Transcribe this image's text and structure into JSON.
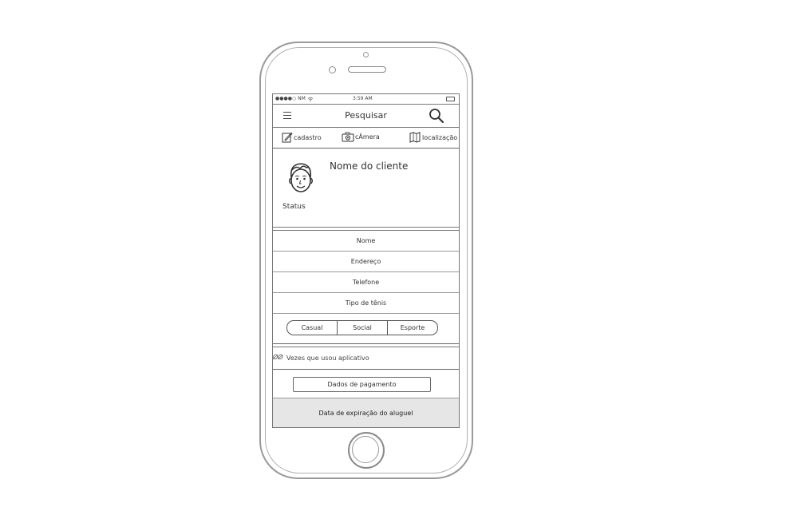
{
  "status_bar": {
    "carrier": "●●●●○ NM",
    "time": "3:59 AM"
  },
  "navbar": {
    "title": "Pesquisar"
  },
  "toolbar": {
    "cadastro_label": "cadastro",
    "camera_label": "cÂmera",
    "localizacao_label": "localização"
  },
  "profile": {
    "client_name": "Nome do cliente",
    "status_label": "Status"
  },
  "form": {
    "fields": [
      "Nome",
      "Endereço",
      "Telefone",
      "Tipo de tênis"
    ],
    "segment": [
      "Casual",
      "Social",
      "Esporte"
    ]
  },
  "usage": {
    "count": "ØØ",
    "label": "Vezes que usou aplicativo"
  },
  "payment_button": "Dados de pagamento",
  "expiry_label": "Data de expiração do aluguel"
}
